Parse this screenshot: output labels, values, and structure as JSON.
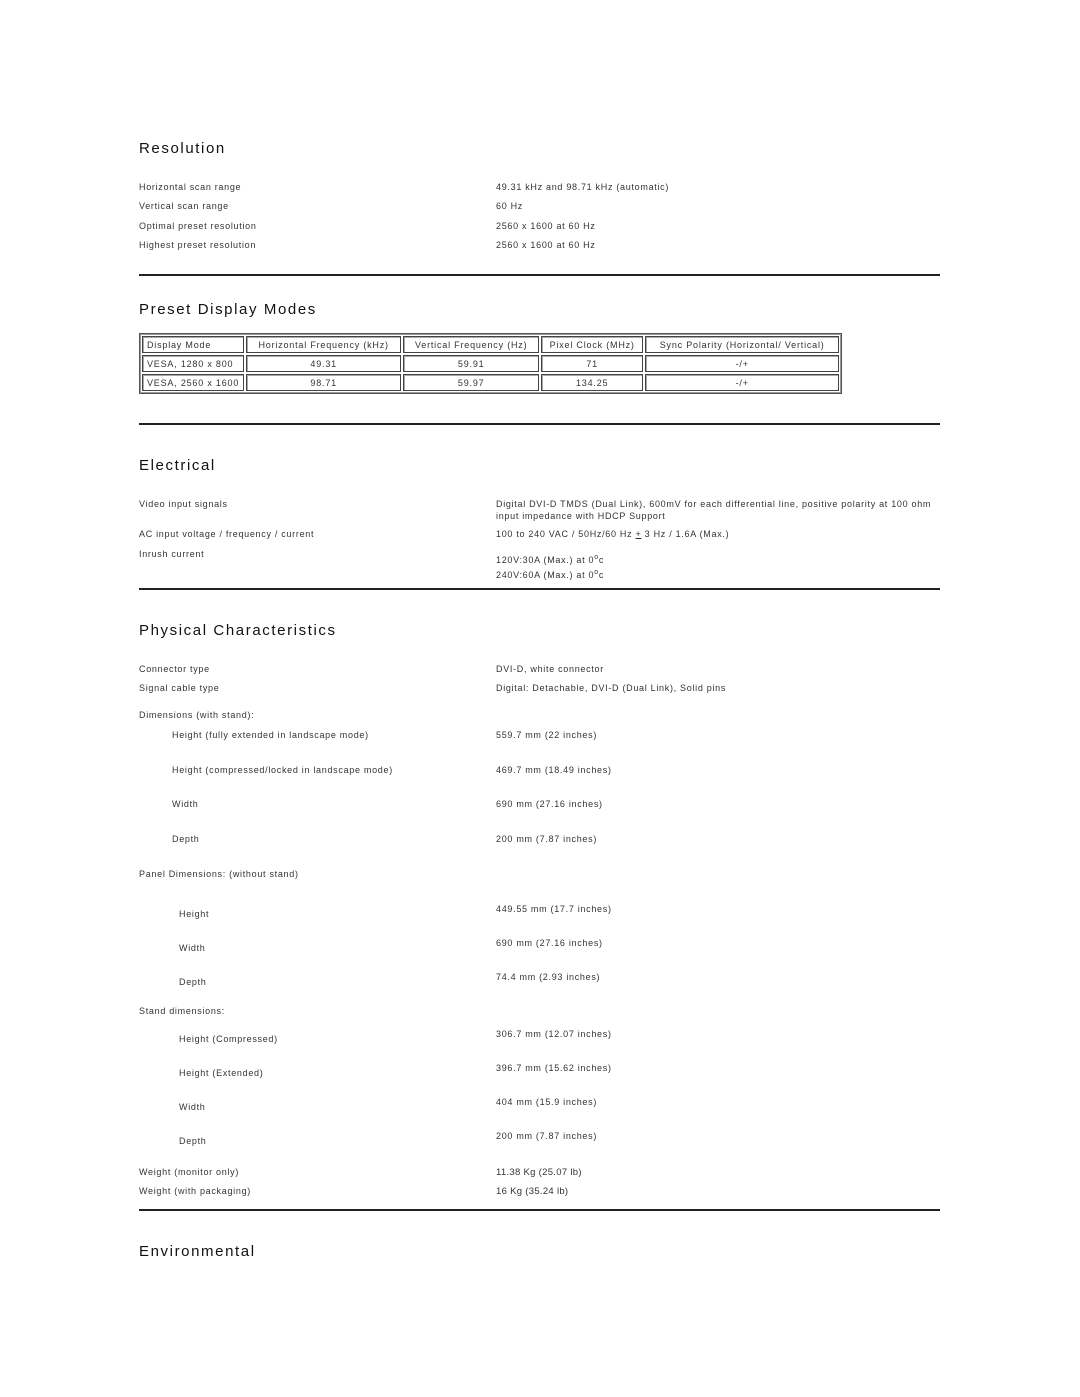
{
  "sections": {
    "resolution": {
      "title": "Resolution",
      "rows": [
        {
          "label": "Horizontal scan range",
          "value": "49.31 kHz and 98.71 kHz (automatic)"
        },
        {
          "label": "Vertical scan range",
          "value": "60 Hz"
        },
        {
          "label": "Optimal preset resolution",
          "value": "2560 x 1600 at 60 Hz"
        },
        {
          "label": "Highest preset resolution",
          "value": "2560 x 1600 at 60 Hz"
        }
      ]
    },
    "preset_modes": {
      "title": "Preset Display Modes",
      "headers": [
        "Display Mode",
        "Horizontal Frequency (kHz)",
        "Vertical Frequency (Hz)",
        "Pixel Clock (MHz)",
        "Sync Polarity (Horizontal/ Vertical)"
      ],
      "rows": [
        [
          "VESA, 1280 x 800",
          "49.31",
          "59.91",
          "71",
          "-/+"
        ],
        [
          "VESA, 2560 x 1600",
          "98.71",
          "59.97",
          "134.25",
          "-/+"
        ]
      ]
    },
    "electrical": {
      "title": "Electrical",
      "video_input": {
        "label": "Video input signals",
        "value": "Digital DVI-D TMDS (Dual Link), 600mV for each differential line, positive polarity at 100 ohm input impedance with HDCP Support"
      },
      "ac_input": {
        "label": "AC input voltage / frequency / current",
        "value_pre": "100 to 240 VAC / 50Hz/60 Hz ",
        "value_pm": "+",
        "value_post": " 3 Hz / 1.6A (Max.)"
      },
      "inrush": {
        "label": "Inrush current",
        "line1": "120V:30A (Max.) at 0",
        "line2": "240V:60A (Max.) at 0",
        "deg": "o",
        "unit": "c"
      }
    },
    "physical": {
      "title": "Physical Characteristics",
      "connector": {
        "label": "Connector type",
        "value": "DVI-D, white connector"
      },
      "cable": {
        "label": "Signal cable type",
        "value": "Digital: Detachable, DVI-D (Dual Link), Solid pins"
      },
      "with_stand_heading": "Dimensions (with stand):",
      "with_stand": [
        {
          "label": "Height (fully extended in landscape mode)",
          "value": "559.7 mm (22 inches)"
        },
        {
          "label": "Height (compressed/locked in landscape mode)",
          "value": "469.7 mm (18.49 inches)"
        },
        {
          "label": "Width",
          "value": "690 mm (27.16 inches)"
        },
        {
          "label": "Depth",
          "value": "200 mm (7.87 inches)"
        }
      ],
      "panel_heading": "Panel Dimensions: (without stand)",
      "panel": [
        {
          "label": "Height",
          "value": "449.55 mm (17.7 inches)"
        },
        {
          "label": "Width",
          "value": "690 mm (27.16 inches)"
        },
        {
          "label": "Depth",
          "value": "74.4 mm (2.93 inches)"
        }
      ],
      "stand_heading": "Stand dimensions:",
      "stand": [
        {
          "label": "Height (Compressed)",
          "value": "306.7 mm (12.07 inches)"
        },
        {
          "label": "Height (Extended)",
          "value": "396.7 mm (15.62 inches)"
        },
        {
          "label": "Width",
          "value": "404 mm (15.9 inches)"
        },
        {
          "label": "Depth",
          "value": "200 mm (7.87 inches)"
        }
      ],
      "weight": [
        {
          "label": "Weight (monitor only)",
          "value": "11.38 Kg (25.07 lb)"
        },
        {
          "label": "Weight (with packaging)",
          "value": "16 Kg (35.24 lb)"
        }
      ]
    },
    "environmental": {
      "title": "Environmental"
    }
  }
}
